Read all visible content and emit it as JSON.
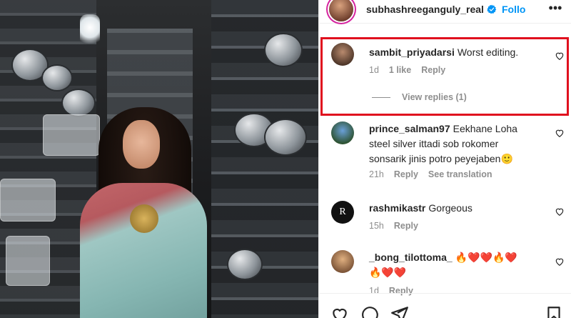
{
  "header": {
    "username": "subhashreeganguly_real",
    "verified_icon": "verified-badge-icon",
    "follow_label": "Follo",
    "more_icon": "more-options-icon"
  },
  "comments": [
    {
      "user": "sambit_priyadarsi",
      "text": "Worst editing.",
      "time": "1d",
      "likes": "1 like",
      "reply": "Reply",
      "view_replies": "View replies (1)",
      "highlighted": true
    },
    {
      "user": "prince_salman97",
      "text": "Eekhane Loha steel silver ittadi sob rokomer sonsarik jinis potro peyejaben🙂",
      "time": "21h",
      "reply": "Reply",
      "translate": "See translation"
    },
    {
      "user": "rashmikastr",
      "text": "Gorgeous",
      "time": "15h",
      "reply": "Reply"
    },
    {
      "user": "_bong_tilottoma_",
      "text": "🔥❤️❤️🔥❤️🔥❤️❤️",
      "time": "1d",
      "reply": "Reply"
    }
  ],
  "colors": {
    "accent": "#0095f6",
    "highlight": "#e0101e",
    "muted": "#8e8e8e",
    "text": "#262626"
  },
  "icons": [
    "like-icon",
    "comment-icon",
    "share-icon",
    "save-icon",
    "heart-icon"
  ]
}
